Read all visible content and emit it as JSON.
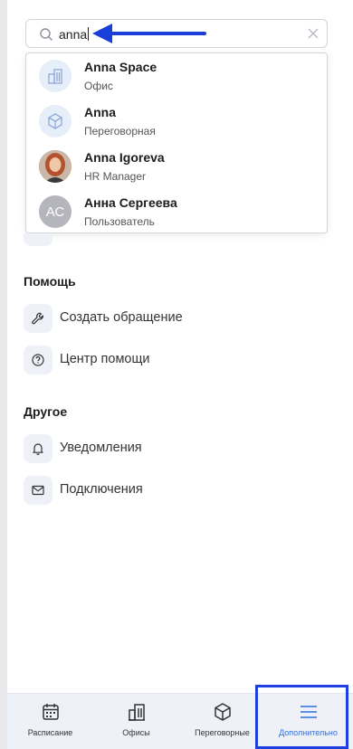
{
  "search": {
    "value": "anna",
    "placeholder": ""
  },
  "suggestions": [
    {
      "name": "Anna Space",
      "subtitle": "Офис",
      "icon": "building-icon"
    },
    {
      "name": "Anna",
      "subtitle": "Переговорная",
      "icon": "cube-icon"
    },
    {
      "name": "Anna Igoreva",
      "subtitle": "HR Manager",
      "icon": "avatar-photo"
    },
    {
      "name": "Анна Сергеева",
      "subtitle": "Пользователь",
      "initials": "АС"
    }
  ],
  "sections": {
    "help": {
      "title": "Помощь",
      "items": [
        {
          "label": "Создать обращение",
          "icon": "wrench-icon"
        },
        {
          "label": "Центр помощи",
          "icon": "question-icon"
        }
      ]
    },
    "other": {
      "title": "Другое",
      "items": [
        {
          "label": "Уведомления",
          "icon": "bell-icon"
        },
        {
          "label": "Подключения",
          "icon": "mail-icon"
        }
      ]
    }
  },
  "tabs": [
    {
      "label": "Расписание",
      "icon": "calendar-icon"
    },
    {
      "label": "Офисы",
      "icon": "building-icon"
    },
    {
      "label": "Переговорные",
      "icon": "cube-icon"
    },
    {
      "label": "Дополнительно",
      "icon": "menu-icon",
      "active": true
    }
  ],
  "colors": {
    "accent": "#2f6ee0",
    "highlight": "#1b3fe0",
    "arrow": "#1a3fd8"
  }
}
